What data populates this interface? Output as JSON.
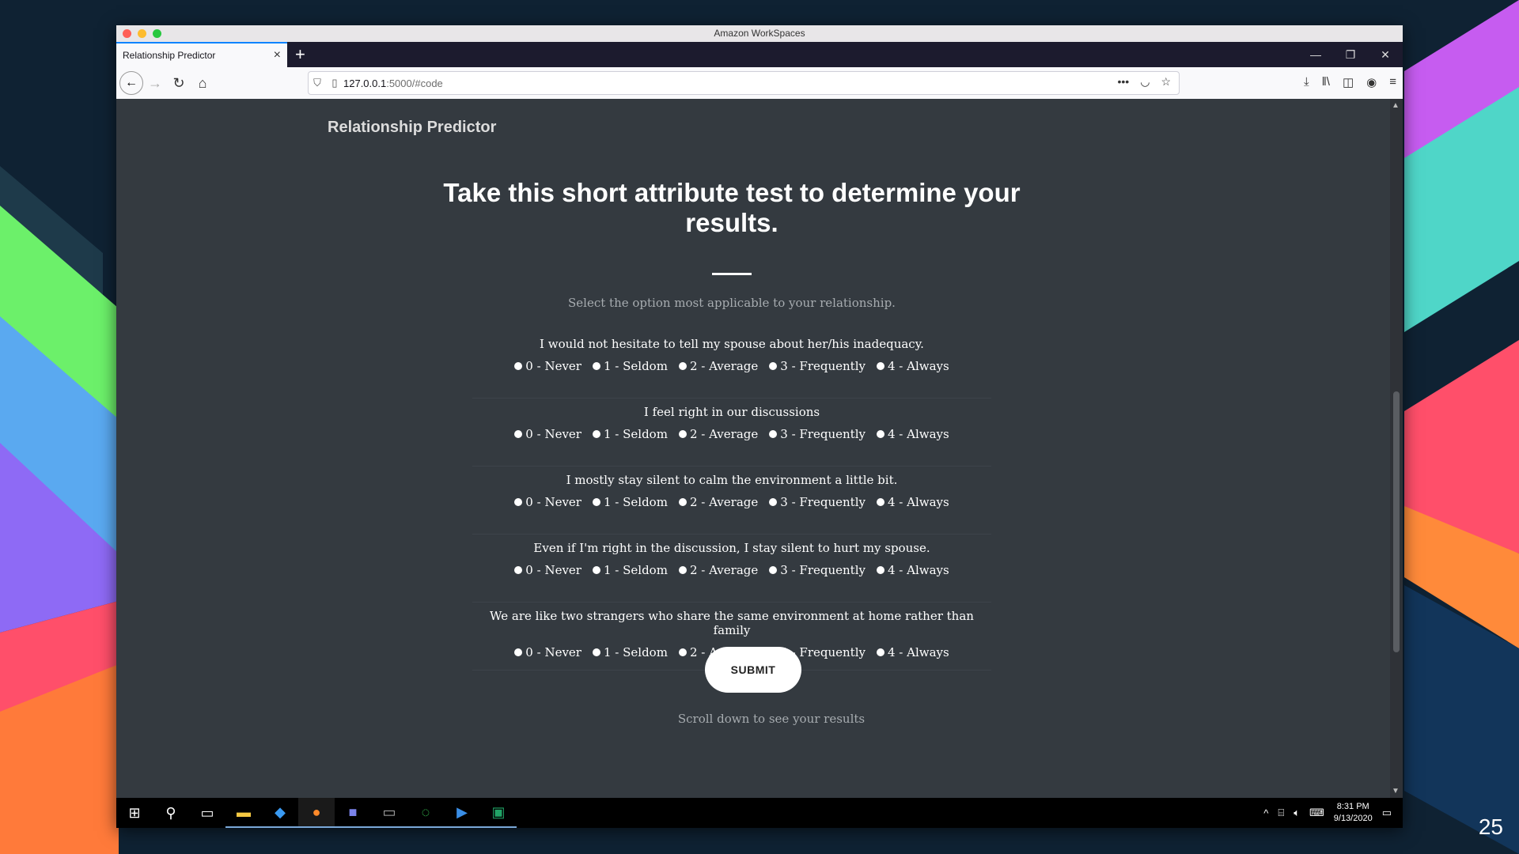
{
  "os_window_title": "Amazon WorkSpaces",
  "slide_number": "25",
  "browser": {
    "tab_title": "Relationship Predictor",
    "url_host": "127.0.0.1",
    "url_rest": ":5000/#code"
  },
  "page": {
    "brand": "Relationship Predictor",
    "heading": "Take this short attribute test to determine your results.",
    "subtitle": "Select the option most applicable to your relationship.",
    "options": [
      "0 - Never",
      "1 - Seldom",
      "2 - Average",
      "3 - Frequently",
      "4 - Always"
    ],
    "questions": [
      "I would not hesitate to tell my spouse about her/his inadequacy.",
      "I feel right in our discussions",
      "I mostly stay silent to calm the environment a little bit.",
      "Even if I'm right in the discussion, I stay silent to hurt my spouse.",
      "We are like two strangers who share the same environment at home rather than family"
    ],
    "submit_label": "SUBMIT",
    "scroll_hint": "Scroll down to see your results"
  },
  "taskbar": {
    "time": "8:31 PM",
    "date": "9/13/2020",
    "apps": [
      "start-icon",
      "search-icon",
      "task-view-icon",
      "file-explorer-icon",
      "vscode-icon",
      "firefox-icon",
      "teams-icon",
      "terminal-icon",
      "progress-icon",
      "powershell-icon",
      "excel-icon"
    ]
  },
  "colors": {
    "page_bg": "#343a40",
    "accent_tab": "#0a84ff"
  }
}
